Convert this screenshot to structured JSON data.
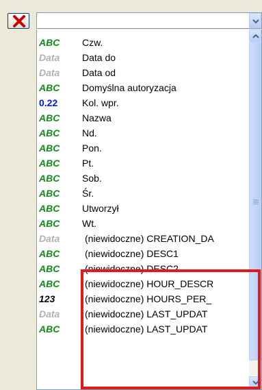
{
  "toolbar": {
    "close_icon": "close-x-icon",
    "close_color": "#cc0000"
  },
  "combo": {
    "value": "",
    "arrow_icon": "chevron-down-icon"
  },
  "field_list": {
    "items": [
      {
        "type": "ABC",
        "label": "Czw."
      },
      {
        "type": "Data",
        "label": "Data do"
      },
      {
        "type": "Data",
        "label": "Data od"
      },
      {
        "type": "ABC",
        "label": "Domyślna autoryzacja"
      },
      {
        "type": "0.22",
        "label": "Kol. wpr."
      },
      {
        "type": "ABC",
        "label": "Nazwa"
      },
      {
        "type": "ABC",
        "label": "Nd."
      },
      {
        "type": "ABC",
        "label": "Pon."
      },
      {
        "type": "ABC",
        "label": "Pt."
      },
      {
        "type": "ABC",
        "label": "Sob."
      },
      {
        "type": "ABC",
        "label": "Śr."
      },
      {
        "type": "ABC",
        "label": "Utworzył"
      },
      {
        "type": "ABC",
        "label": "Wt."
      },
      {
        "type": "Data",
        "label": "(niewidoczne) CREATION_DA"
      },
      {
        "type": "ABC",
        "label": "(niewidoczne) DESC1"
      },
      {
        "type": "ABC",
        "label": "(niewidoczne) DESC2"
      },
      {
        "type": "ABC",
        "label": "(niewidoczne) HOUR_DESCR"
      },
      {
        "type": "123",
        "label": "(niewidoczne) HOURS_PER_"
      },
      {
        "type": "Data",
        "label": "(niewidoczne) LAST_UPDAT"
      },
      {
        "type": "ABC",
        "label": "(niewidoczne) LAST_UPDAT"
      }
    ]
  },
  "type_colors": {
    "ABC": "#148a1e",
    "Data": "#b0b0b0",
    "0.22": "#0019e0",
    "123": "#000000"
  },
  "highlight_color": "#e2181b"
}
